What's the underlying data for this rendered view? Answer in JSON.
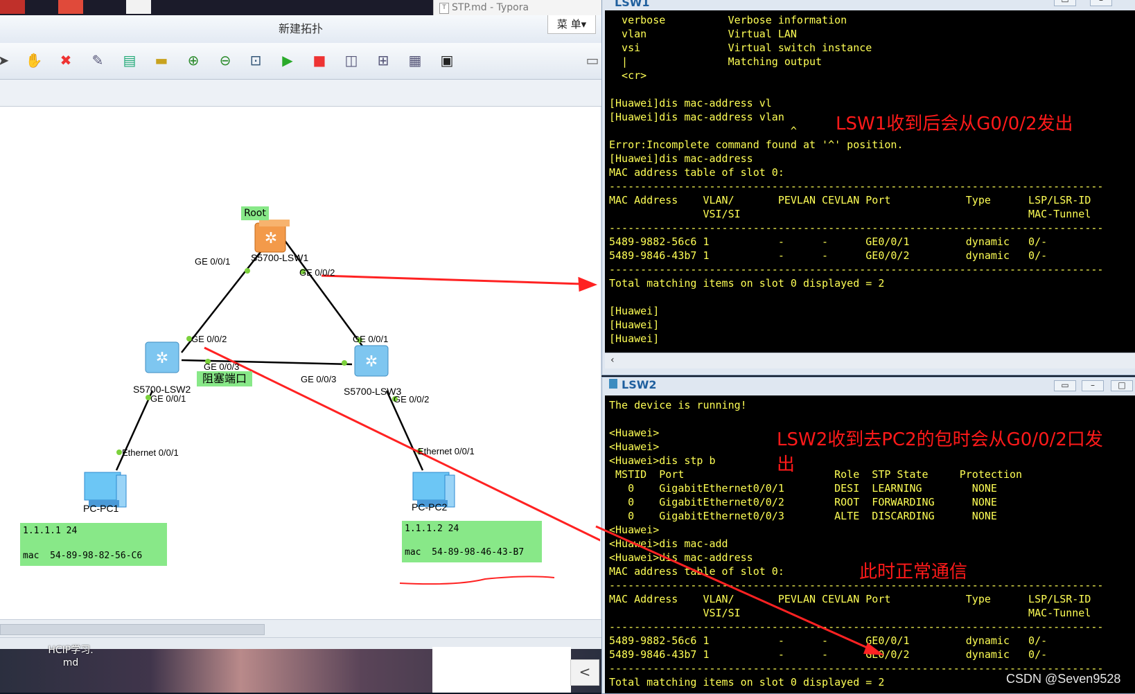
{
  "desktop": {
    "typora_tab": "STP.md - Typora",
    "typora_tab_icon": "T",
    "desktop_file_label": "HCIP学习.\nmd",
    "back_arrow": "<"
  },
  "ensp": {
    "title": "新建拓扑",
    "menu_label": "菜 单▾"
  },
  "toolbar_icons": [
    "pointer-icon",
    "hand-icon",
    "delete-icon",
    "edit-icon",
    "text-icon",
    "rectangle-icon",
    "zoom-in-icon",
    "zoom-out-icon",
    "fit-icon",
    "start-icon",
    "stop-icon",
    "capture-icon",
    "topology-icon",
    "table-icon",
    "console-icon"
  ],
  "topology": {
    "root_label": "Root",
    "devices": {
      "lsw1": "S5700-LSW1",
      "lsw2": "S5700-LSW2",
      "lsw3": "S5700-LSW3",
      "pc1": "PC-PC1",
      "pc2": "PC-PC2"
    },
    "ports": {
      "lsw1_g1": "GE 0/0/1",
      "lsw1_g2": "GE 0/0/2",
      "lsw2_g2": "GE 0/0/2",
      "lsw2_g3": "GE 0/0/3",
      "lsw2_g1": "GE 0/0/1",
      "lsw3_g1": "GE 0/0/1",
      "lsw3_g3": "GE 0/0/3",
      "lsw3_g2": "GE 0/0/2",
      "pc1_eth": "Ethernet 0/0/1",
      "pc2_eth": "Ethernet 0/0/1"
    },
    "blocked_label": "阻塞端口",
    "pc1_info": {
      "ip": "1.1.1.1 24",
      "mac": "mac  54-89-98-82-56-C6"
    },
    "pc2_info": {
      "ip": "1.1.1.2 24",
      "mac": "mac  54-89-98-46-43-B7"
    },
    "colors": {
      "link": "#000000",
      "port_dot": "#7cd13c",
      "annotation": "#ff1a1a",
      "label_bg": "#88e888"
    }
  },
  "lsw1_window": {
    "title": "LSW1",
    "lines": [
      "  verbose          Verbose information",
      "  vlan             Virtual LAN",
      "  vsi              Virtual switch instance",
      "  |                Matching output",
      "  <cr>",
      "",
      "[Huawei]dis mac-address vl",
      "[Huawei]dis mac-address vlan",
      "                             ^",
      "Error:Incomplete command found at '^' position.",
      "[Huawei]dis mac-address",
      "MAC address table of slot 0:",
      "-------------------------------------------------------------------------------",
      "MAC Address    VLAN/       PEVLAN CEVLAN Port            Type      LSP/LSR-ID",
      "               VSI/SI                                              MAC-Tunnel",
      "-------------------------------------------------------------------------------",
      "5489-9882-56c6 1           -      -      GE0/0/1         dynamic   0/-",
      "5489-9846-43b7 1           -      -      GE0/0/2         dynamic   0/-",
      "-------------------------------------------------------------------------------",
      "Total matching items on slot 0 displayed = 2",
      "",
      "[Huawei]",
      "[Huawei]",
      "[Huawei]"
    ],
    "annotation": "LSW1收到后会从G0/0/2发出"
  },
  "lsw2_window": {
    "title": "LSW2",
    "lines": [
      "The device is running!",
      "",
      "<Huawei>",
      "<Huawei>",
      "<Huawei>dis stp b",
      " MSTID  Port                        Role  STP State     Protection",
      "   0    GigabitEthernet0/0/1        DESI  LEARNING        NONE",
      "   0    GigabitEthernet0/0/2        ROOT  FORWARDING      NONE",
      "   0    GigabitEthernet0/0/3        ALTE  DISCARDING      NONE",
      "<Huawei>",
      "<Huawei>dis mac-add",
      "<Huawei>dis mac-address",
      "MAC address table of slot 0:",
      "-------------------------------------------------------------------------------",
      "MAC Address    VLAN/       PEVLAN CEVLAN Port            Type      LSP/LSR-ID",
      "               VSI/SI                                              MAC-Tunnel",
      "-------------------------------------------------------------------------------",
      "5489-9882-56c6 1           -      -      GE0/0/1         dynamic   0/-",
      "5489-9846-43b7 1           -      -      GE0/0/2         dynamic   0/-",
      "-------------------------------------------------------------------------------",
      "Total matching items on slot 0 displayed = 2"
    ],
    "annotation_line1": "LSW2收到去PC2的包时会从G0/0/2口发",
    "annotation_line2": "出",
    "annotation_normal": "此时正常通信"
  },
  "watermark": "CSDN @Seven9528"
}
